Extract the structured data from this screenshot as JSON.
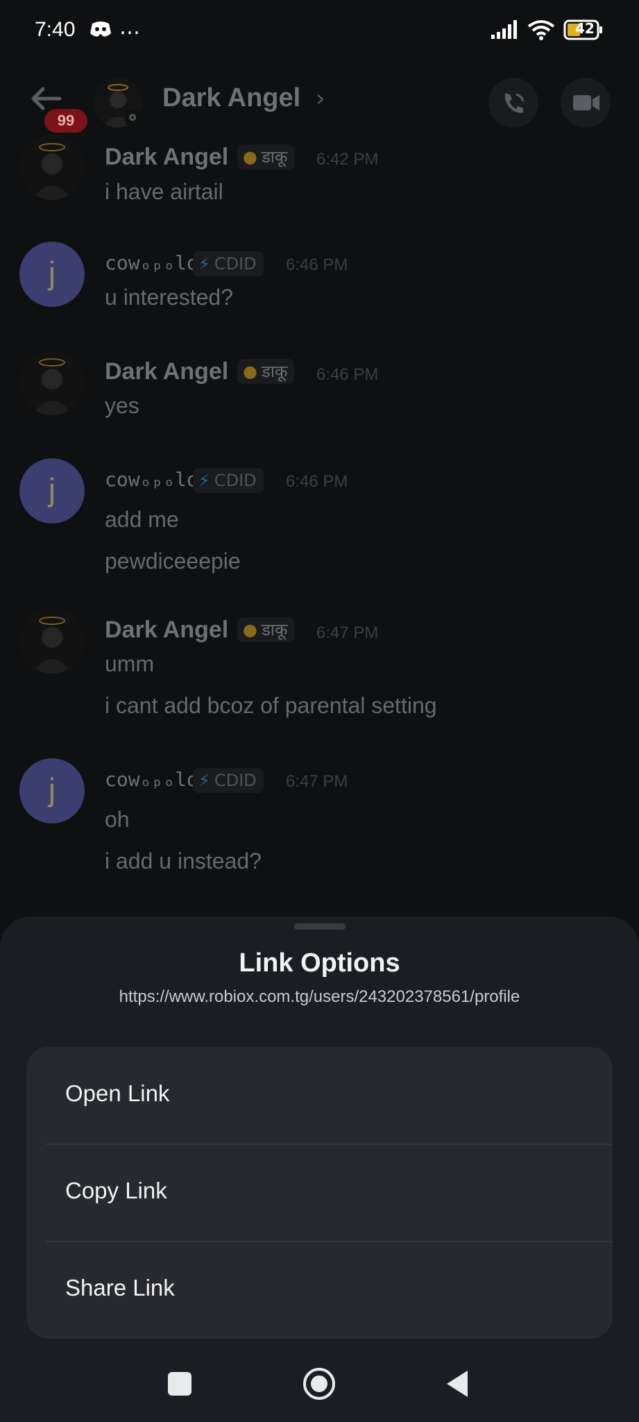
{
  "status_bar": {
    "time": "7:40",
    "overflow": "…",
    "battery": "42",
    "icons": [
      "discord-icon",
      "signal-icon",
      "wifi-icon",
      "battery-icon"
    ]
  },
  "header": {
    "title": "Dark Angel",
    "unread_badge": "99",
    "icons": [
      "back-arrow-icon",
      "chevron-right-icon",
      "phone-call-icon",
      "video-camera-icon"
    ]
  },
  "messages": [
    {
      "user": "Dark Angel",
      "tag": "डाकू",
      "tag_icon": "skull-icon",
      "time": "6:42 PM",
      "lines": [
        "i have airtail"
      ]
    },
    {
      "user": "cowₒₚₒlos",
      "tag": "CDID",
      "tag_icon": "lightning-icon",
      "time": "6:46 PM",
      "lines": [
        "u interested?"
      ]
    },
    {
      "user": "Dark Angel",
      "tag": "डाकू",
      "tag_icon": "skull-icon",
      "time": "6:46 PM",
      "lines": [
        "yes"
      ]
    },
    {
      "user": "cowₒₚₒlos",
      "tag": "CDID",
      "tag_icon": "lightning-icon",
      "time": "6:46 PM",
      "lines": [
        "add me",
        "pewdiceeepie"
      ]
    },
    {
      "user": "Dark Angel",
      "tag": "डाकू",
      "tag_icon": "skull-icon",
      "time": "6:47 PM",
      "lines": [
        "umm",
        "i cant add bcoz of parental setting"
      ]
    },
    {
      "user": "cowₒₚₒlos",
      "tag": "CDID",
      "tag_icon": "lightning-icon",
      "time": "6:47 PM",
      "lines": [
        "oh",
        "i add u instead?"
      ]
    }
  ],
  "sheet": {
    "title": "Link Options",
    "url": "https://www.robiox.com.tg/users/243202378561/profile",
    "options": [
      "Open Link",
      "Copy Link",
      "Share Link"
    ]
  },
  "avatar_letter": "j",
  "colors": {
    "background": "#0f1012",
    "sheet": "#1c1d22",
    "option_group": "#28292f",
    "badge": "#7a1418",
    "cdid_accent": "#2a8fb8",
    "skull_tag": "#b58a1e"
  }
}
